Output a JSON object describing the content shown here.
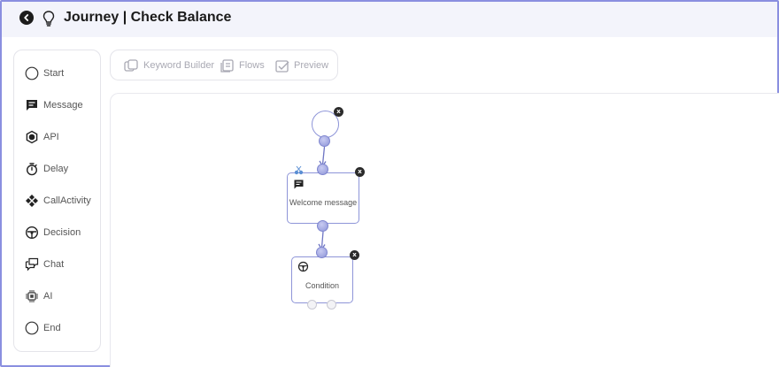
{
  "header": {
    "title": "Journey | Check Balance",
    "back_icon": "back-arrow-icon",
    "journey_icon": "lightbulb-icon"
  },
  "palette": {
    "items": [
      {
        "label": "Start",
        "icon": "circle-icon"
      },
      {
        "label": "Message",
        "icon": "message-icon"
      },
      {
        "label": "API",
        "icon": "api-icon"
      },
      {
        "label": "Delay",
        "icon": "stopwatch-icon"
      },
      {
        "label": "CallActivity",
        "icon": "call-activity-icon"
      },
      {
        "label": "Decision",
        "icon": "decision-icon"
      },
      {
        "label": "Chat",
        "icon": "chat-icon"
      },
      {
        "label": "AI",
        "icon": "ai-chip-icon"
      },
      {
        "label": "End",
        "icon": "circle-icon"
      }
    ]
  },
  "tabs": [
    {
      "label": "Keyword Builder",
      "icon": "keyword-builder-icon"
    },
    {
      "label": "Flows",
      "icon": "flows-icon"
    },
    {
      "label": "Preview",
      "icon": "preview-icon"
    }
  ],
  "canvas": {
    "nodes": {
      "message": {
        "label": "Welcome message"
      },
      "decision": {
        "label": "Condition"
      }
    },
    "delete_label": "x"
  },
  "colors": {
    "accent": "#8e95d8",
    "frame_border": "#8a8fe0",
    "header_bg": "#f3f4fb"
  }
}
